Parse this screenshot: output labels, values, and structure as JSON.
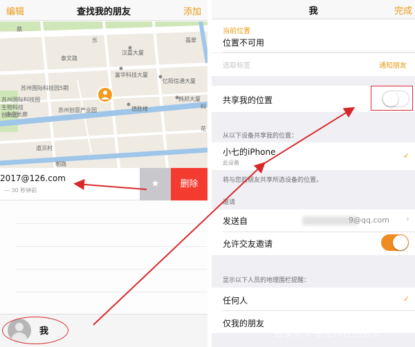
{
  "left": {
    "nav": {
      "edit": "编辑",
      "title": "查找我的朋友",
      "add": "添加"
    },
    "map": {
      "labels": [
        "鼎",
        "乐",
        "汉嘉大厦",
        "翡翠",
        "泰文路",
        "富华科技大厦",
        "忆阳信通大厦",
        "苏州国际科技园5期",
        "苏州国际科技园",
        "生物科技",
        "创新园",
        "企业长廊",
        "苏州创意产业园",
        "德胜楼",
        "韩邦大厦",
        "科",
        "花",
        "道浜村",
        "朝路"
      ]
    },
    "friend": {
      "email": "2017@126.com",
      "time": "— 30 秒钟前",
      "star": "★",
      "delete": "删除"
    },
    "me": {
      "label": "我"
    }
  },
  "right": {
    "nav": {
      "title": "我",
      "done": "完成"
    },
    "location": {
      "label": "当前位置",
      "value": "位置不可用"
    },
    "label_row": {
      "placeholder": "选取标签",
      "notify": "通知朋友"
    },
    "share": {
      "label": "共享我的位置",
      "on": false
    },
    "devices_header": "从以下设备共享我的位置：",
    "device": {
      "name": "小七的iPhone",
      "sub": "此设备",
      "check": "✓"
    },
    "share_footer": "将与您的朋友共享所选设备的位置。",
    "invites_header": "邀请",
    "send_from": {
      "label": "发送自",
      "value": "9@qq.com",
      "chevron": "›"
    },
    "allow_invites": {
      "label": "允许交友邀请",
      "on": true
    },
    "fence_header": "显示以下人员的地理围栏提醒：",
    "fence_options": [
      {
        "label": "任何人",
        "check": "✓"
      },
      {
        "label": "仅我的朋友"
      }
    ]
  },
  "watermark": "百家号 / 专注科技的达人",
  "colors": {
    "accent": "#e89b16",
    "delete": "#f43b30",
    "annotation": "#d8292a",
    "toggle_on": "#f08b1f"
  }
}
